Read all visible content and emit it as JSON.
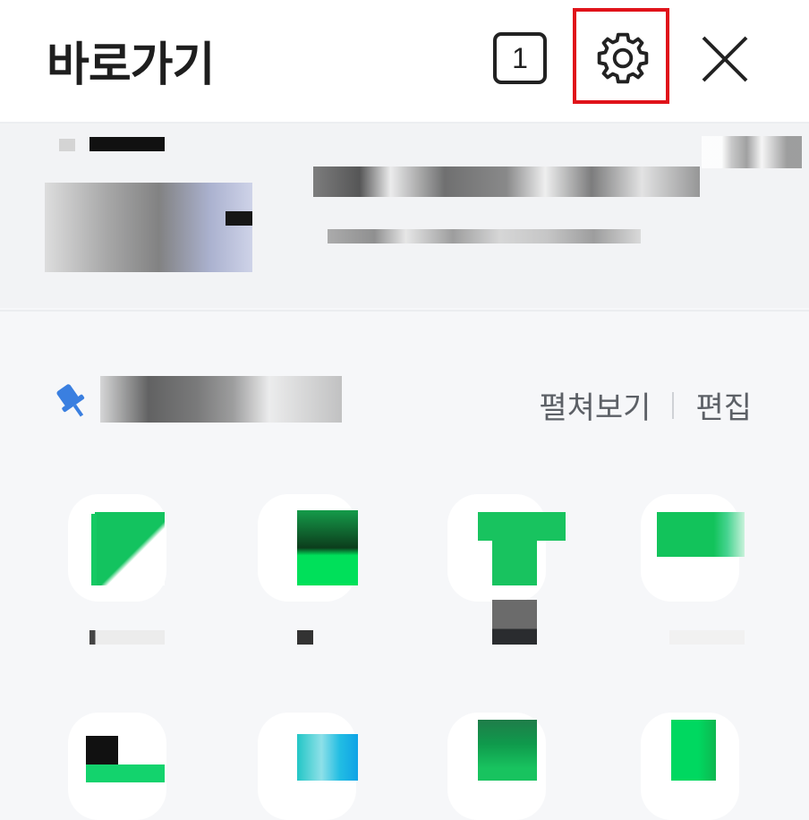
{
  "header": {
    "title": "바로가기",
    "tab_count": "1",
    "settings_icon": "gear-icon",
    "close_icon": "close-icon",
    "highlight_color": "#e0131a"
  },
  "section": {
    "pin_icon": "pin-icon",
    "expand_label": "펼쳐보기",
    "edit_label": "편집",
    "pin_color": "#3a7fe0"
  }
}
